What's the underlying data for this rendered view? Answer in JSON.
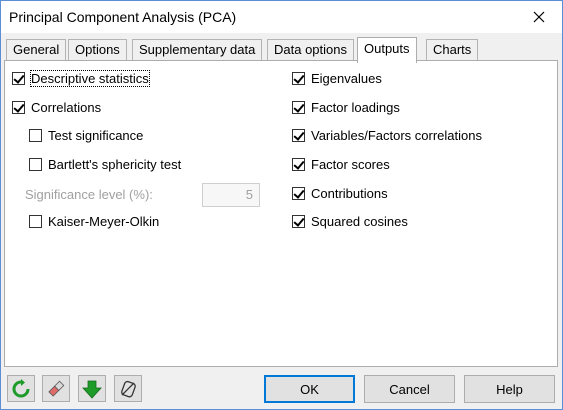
{
  "window": {
    "title": "Principal Component Analysis (PCA)"
  },
  "tabs": [
    {
      "label": "General"
    },
    {
      "label": "Options"
    },
    {
      "label": "Supplementary data"
    },
    {
      "label": "Data options"
    },
    {
      "label": "Outputs",
      "active": true
    },
    {
      "label": "Charts"
    }
  ],
  "outputs": {
    "left": {
      "descriptive_statistics": {
        "label": "Descriptive statistics",
        "checked": true
      },
      "correlations": {
        "label": "Correlations",
        "checked": true
      },
      "test_significance": {
        "label": "Test significance",
        "checked": false
      },
      "bartlett": {
        "label": "Bartlett's sphericity test",
        "checked": false
      },
      "significance_level": {
        "label": "Significance level (%):",
        "value": "5"
      },
      "kmo": {
        "label": "Kaiser-Meyer-Olkin",
        "checked": false
      }
    },
    "right": {
      "eigenvalues": {
        "label": "Eigenvalues",
        "checked": true
      },
      "factor_loadings": {
        "label": "Factor loadings",
        "checked": true
      },
      "var_factor_corr": {
        "label": "Variables/Factors correlations",
        "checked": true
      },
      "factor_scores": {
        "label": "Factor scores",
        "checked": true
      },
      "contributions": {
        "label": "Contributions",
        "checked": true
      },
      "squared_cosines": {
        "label": "Squared cosines",
        "checked": true
      }
    }
  },
  "footer": {
    "icons": [
      "reset-icon",
      "eraser-icon",
      "down-arrow-icon",
      "clear-selection-icon"
    ],
    "ok_label": "OK",
    "cancel_label": "Cancel",
    "help_label": "Help"
  },
  "colors": {
    "accent": "#0078d7",
    "green": "#1f9b2a"
  }
}
